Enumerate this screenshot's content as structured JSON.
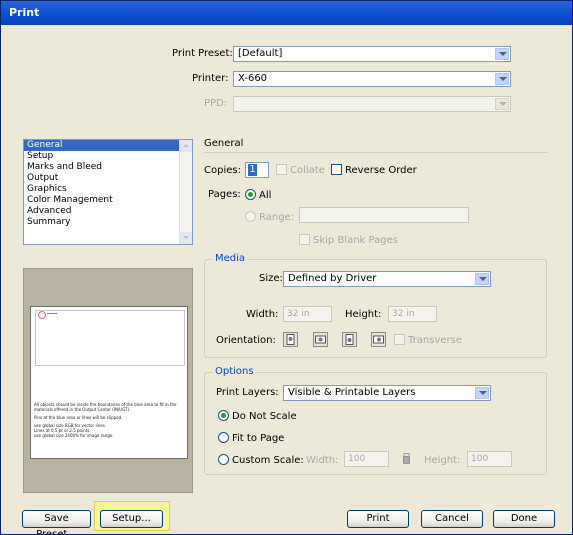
{
  "window": {
    "title": "Print"
  },
  "header": {
    "print_preset_label": "Print Preset:",
    "print_preset_value": "[Default]",
    "printer_label": "Printer:",
    "printer_value": "X-660",
    "ppd_label": "PPD:",
    "ppd_value": ""
  },
  "sidebar": {
    "items": [
      {
        "label": "General",
        "selected": true
      },
      {
        "label": "Setup"
      },
      {
        "label": "Marks and Bleed"
      },
      {
        "label": "Output"
      },
      {
        "label": "Graphics"
      },
      {
        "label": "Color Management"
      },
      {
        "label": "Advanced"
      },
      {
        "label": "Summary"
      }
    ]
  },
  "preview": {
    "lines": [
      "All objects should be inside the boundaries of the blue area to fit in the",
      "materials offered in the Output Center (IN/UGT).",
      "Pins at the blue area or lines will be clipped.",
      "use global size RGB for vector lines.",
      "Lines at 0.5 pt or 2.5 points.",
      "use global size 2400% for image range."
    ]
  },
  "general": {
    "section_title": "General",
    "copies_label": "Copies:",
    "copies_value": "1",
    "collate_label": "Collate",
    "reverse_order_label": "Reverse Order",
    "pages_label": "Pages:",
    "all_label": "All",
    "range_label": "Range:",
    "skip_blank_label": "Skip Blank Pages"
  },
  "media": {
    "section_title": "Media",
    "size_label": "Size:",
    "size_value": "Defined by Driver",
    "width_label": "Width:",
    "width_value": "32 in",
    "height_label": "Height:",
    "height_value": "32 in",
    "orientation_label": "Orientation:",
    "transverse_label": "Transverse"
  },
  "options": {
    "section_title": "Options",
    "print_layers_label": "Print Layers:",
    "print_layers_value": "Visible & Printable Layers",
    "do_not_scale_label": "Do Not Scale",
    "fit_to_page_label": "Fit to Page",
    "custom_scale_label": "Custom Scale:",
    "scale_width_label": "Width:",
    "scale_width_value": "100",
    "scale_height_label": "Height:",
    "scale_height_value": "100"
  },
  "buttons": {
    "save_preset": "Save Preset...",
    "setup": "Setup...",
    "print": "Print",
    "cancel": "Cancel",
    "done": "Done"
  },
  "colors": {
    "title_bar": "#0a4fd0",
    "dialog_bg": "#ece9d8",
    "section_title": "#0046d5",
    "selection": "#316ac5",
    "setup_highlight": "#f7f59a"
  }
}
